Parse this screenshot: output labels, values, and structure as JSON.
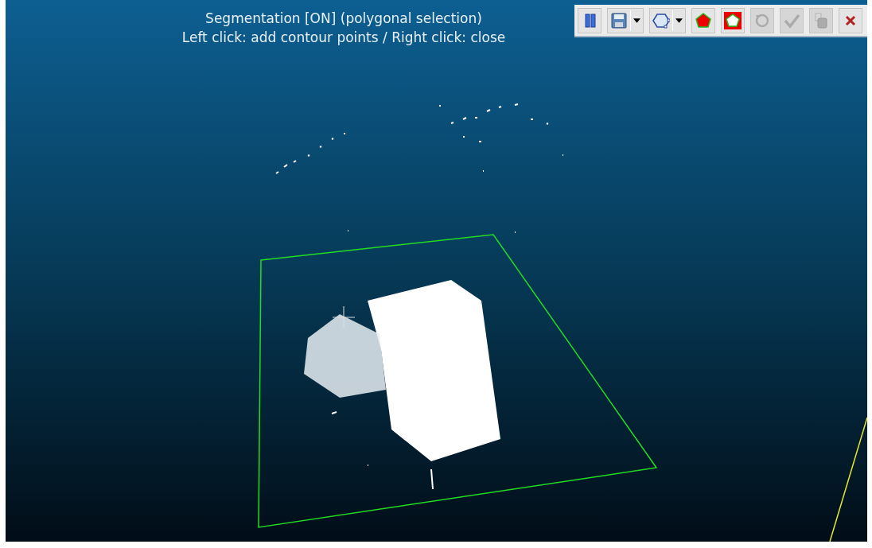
{
  "overlay": {
    "title": "Segmentation [ON] (polygonal selection)",
    "hint": "Left click: add contour points / Right click: close"
  },
  "toolbar": {
    "buttons": [
      {
        "kind": "pause",
        "disabled": false,
        "dropdown": false
      },
      {
        "kind": "save",
        "disabled": false,
        "dropdown": true
      },
      {
        "kind": "polygon",
        "disabled": false,
        "dropdown": true
      },
      {
        "kind": "inside",
        "disabled": false,
        "dropdown": false
      },
      {
        "kind": "outside",
        "disabled": false,
        "dropdown": false
      },
      {
        "kind": "reset",
        "disabled": true,
        "dropdown": false
      },
      {
        "kind": "confirm",
        "disabled": true,
        "dropdown": false
      },
      {
        "kind": "trash",
        "disabled": true,
        "dropdown": false
      },
      {
        "kind": "cancel",
        "disabled": false,
        "dropdown": false
      }
    ]
  }
}
